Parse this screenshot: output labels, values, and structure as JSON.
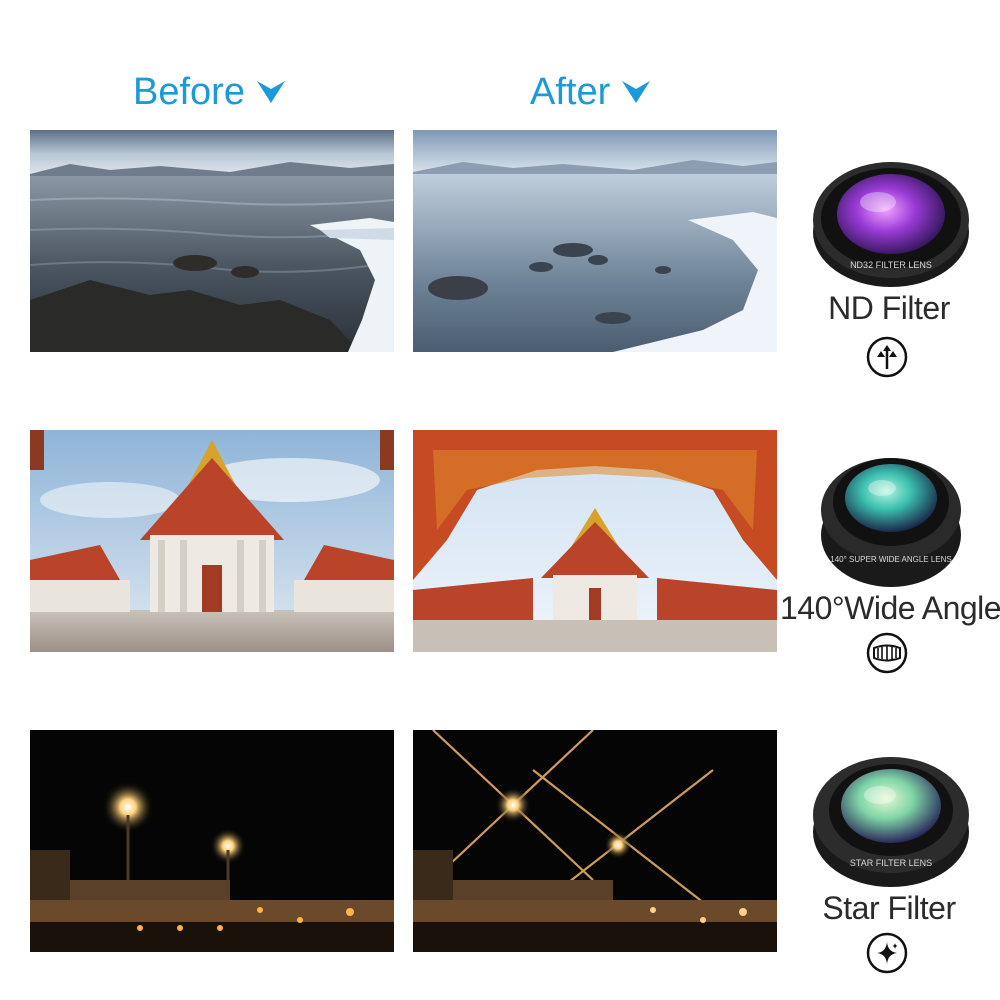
{
  "headers": {
    "before": "Before",
    "after": "After"
  },
  "rows": [
    {
      "id": "nd",
      "label": "ND Filter",
      "lens_text": "ND32 FILTER LENS",
      "icon": "nd-filter-icon"
    },
    {
      "id": "wide",
      "label": "140°Wide Angle",
      "lens_text": "140° SUPER WIDE ANGLE LENS",
      "icon": "wide-angle-icon"
    },
    {
      "id": "star",
      "label": "Star Filter",
      "lens_text": "STAR FILTER LENS",
      "icon": "star-filter-icon"
    }
  ],
  "colors": {
    "accent": "#1a9ad9",
    "text": "#2b2b2b"
  }
}
